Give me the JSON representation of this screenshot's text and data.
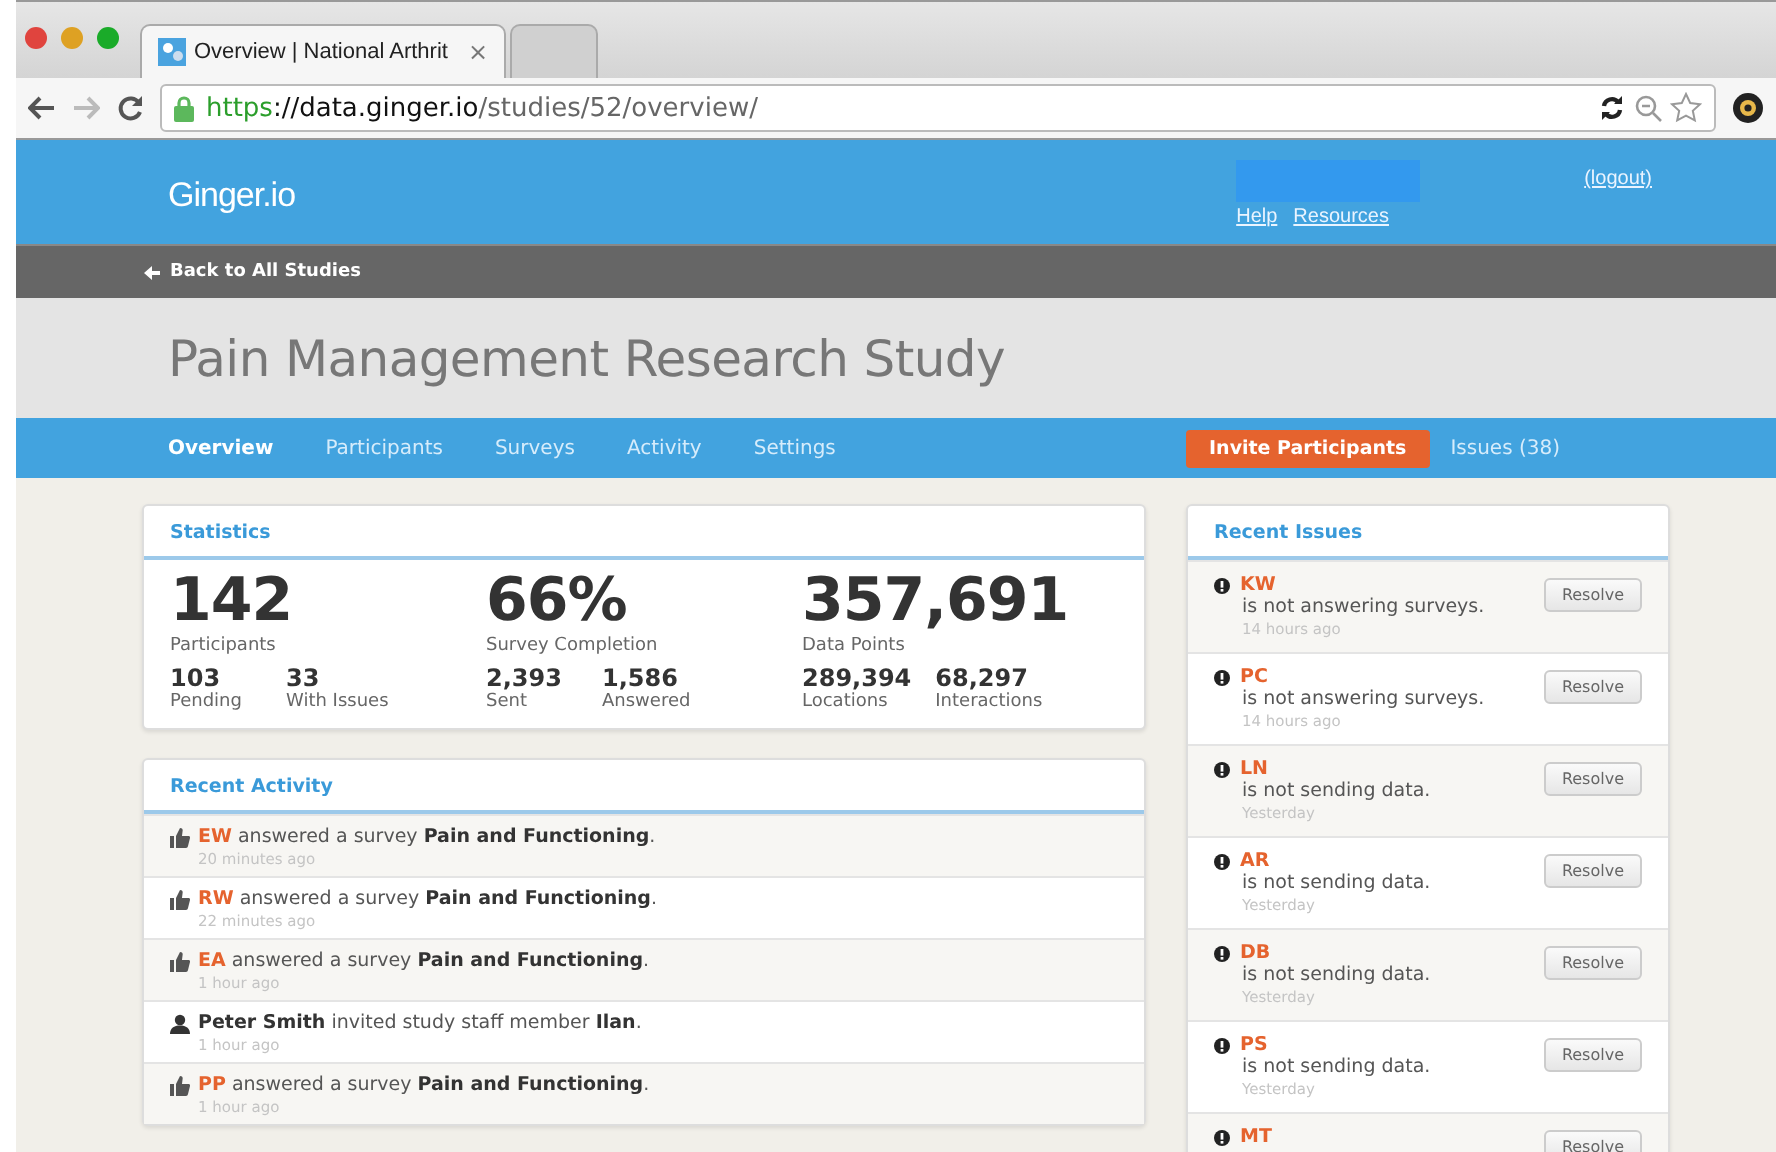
{
  "browser": {
    "tabs": [
      {
        "title": "Overview | National Arthrit",
        "selected": true
      },
      {
        "selected": false
      }
    ],
    "tab_close": "×",
    "url_scheme": "https",
    "url_host": "://data.ginger.io",
    "url_path": "/studies/52/overview/"
  },
  "header": {
    "logo": "Ginger.io",
    "links": [
      "Help",
      "Resources"
    ],
    "logout": "(logout)"
  },
  "back_link": "Back to All Studies",
  "study_title": "Pain Management Research Study",
  "nav": {
    "tabs": [
      {
        "label": "Overview",
        "selected": true
      },
      {
        "label": "Participants",
        "selected": false
      },
      {
        "label": "Surveys",
        "selected": false
      },
      {
        "label": "Activity",
        "selected": false
      },
      {
        "label": "Settings",
        "selected": false
      }
    ],
    "invite_button": "Invite Participants",
    "issues_link": "Issues (38)"
  },
  "statistics": {
    "title": "Statistics",
    "groups": [
      {
        "value": "142",
        "label": "Participants",
        "sub": [
          {
            "value": "103",
            "label": "Pending"
          },
          {
            "value": "33",
            "label": "With Issues"
          }
        ]
      },
      {
        "value": "66%",
        "label": "Survey Completion",
        "sub": [
          {
            "value": "2,393",
            "label": "Sent"
          },
          {
            "value": "1,586",
            "label": "Answered"
          }
        ]
      },
      {
        "value": "357,691",
        "label": "Data Points",
        "sub": [
          {
            "value": "289,394",
            "label": "Locations"
          },
          {
            "value": "68,297",
            "label": "Interactions"
          }
        ]
      }
    ]
  },
  "recent_activity": {
    "title": "Recent Activity",
    "items": [
      {
        "kind": "survey",
        "actor": "EW",
        "text": " answered a survey **Pain and Functioning**.",
        "time": "20 minutes ago"
      },
      {
        "kind": "survey",
        "actor": "RW",
        "text": " answered a survey **Pain and Functioning**.",
        "time": "22 minutes ago"
      },
      {
        "kind": "survey",
        "actor": "EA",
        "text": " answered a survey **Pain and Functioning**.",
        "time": "1 hour ago"
      },
      {
        "kind": "staff",
        "actor": "Peter Smith",
        "text": " invited study staff member **Ilan**.",
        "time": "1 hour ago"
      },
      {
        "kind": "survey",
        "actor": "PP",
        "text": " answered a survey **Pain and Functioning**.",
        "time": "1 hour ago"
      }
    ]
  },
  "recent_issues": {
    "title": "Recent Issues",
    "items": [
      {
        "who": "KW",
        "message": "is not answering surveys.",
        "time": "14 hours ago",
        "button": "Resolve"
      },
      {
        "who": "PC",
        "message": "is not answering surveys.",
        "time": "14 hours ago",
        "button": "Resolve"
      },
      {
        "who": "LN",
        "message": "is not sending data.",
        "time": "Yesterday",
        "button": "Resolve"
      },
      {
        "who": "AR",
        "message": "is not sending data.",
        "time": "Yesterday",
        "button": "Resolve"
      },
      {
        "who": "DB",
        "message": "is not sending data.",
        "time": "Yesterday",
        "button": "Resolve"
      },
      {
        "who": "PS",
        "message": "is not sending data.",
        "time": "Yesterday",
        "button": "Resolve"
      },
      {
        "who": "MT",
        "button": "Resolve"
      }
    ]
  }
}
